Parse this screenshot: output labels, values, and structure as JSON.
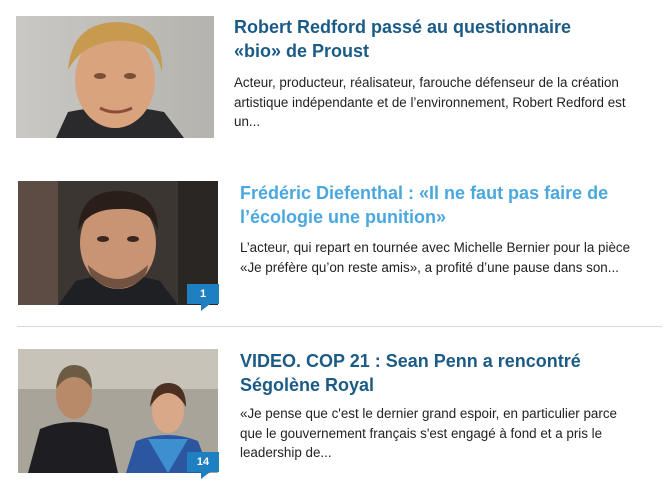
{
  "articles": [
    {
      "title_line1": "Robert Redford passé au questionnaire",
      "title_line2": "«bio» de Proust",
      "excerpt_line1": "Acteur, producteur, réalisateur, farouche défenseur de la création",
      "excerpt_line2": "artistique indépendante et de l’environnement, Robert Redford est",
      "excerpt_line3": "un...",
      "comments": ""
    },
    {
      "title_line1": "Frédéric Diefenthal : «Il ne faut pas faire de",
      "title_line2": "l’écologie une punition»",
      "excerpt_line1": "L’acteur, qui repart en tournée avec Michelle Bernier pour la pièce",
      "excerpt_line2": "«Je préfère qu’on reste amis», a profité d’une pause dans son...",
      "comments": "1"
    },
    {
      "title_line1": "VIDEO. COP 21 : Sean Penn a rencontré",
      "title_line2": "Ségolène Royal",
      "excerpt_line1": "«Je pense que c'est le dernier grand espoir, en particulier parce",
      "excerpt_line2": "que le gouvernement français s'est engagé à fond et a pris le",
      "excerpt_line3": "leadership de...",
      "comments": "14"
    }
  ],
  "colors": {
    "title": "#1b5b86",
    "title_hover": "#4aa8df",
    "badge": "#1e7fc1"
  }
}
